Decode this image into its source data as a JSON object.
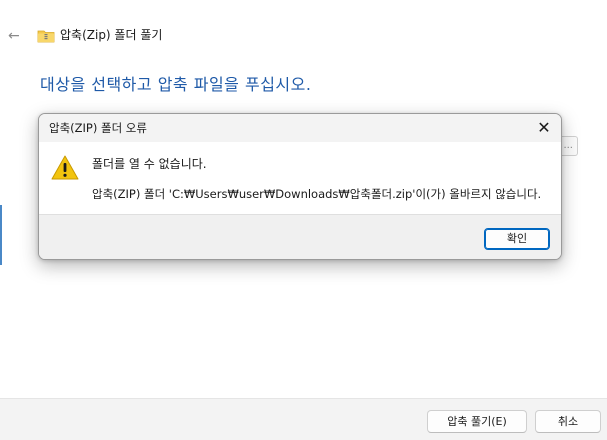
{
  "wizard": {
    "title": "압축(Zip) 폴더 풀기",
    "back_icon": "arrow-left-icon",
    "folder_icon": "zip-folder-icon",
    "heading": "대상을 선택하고 압축 파일을 푸십시오.",
    "browse_stub": "...",
    "buttons": {
      "extract": "압축 풀기(E)",
      "cancel": "취소"
    },
    "colors": {
      "heading": "#1f5aa8"
    }
  },
  "dialog": {
    "title": "압축(ZIP) 폴더 오류",
    "close_icon": "close-icon",
    "warning_icon": "warning-icon",
    "message": "폴더를 열 수 없습니다.",
    "detail": "압축(ZIP) 폴더 'C:₩Users₩user₩Downloads₩압축폴더.zip'이(가) 올바르지 않습니다.",
    "ok_label": "확인",
    "colors": {
      "warning": "#f2c40f",
      "ok_border": "#0067c0"
    }
  }
}
